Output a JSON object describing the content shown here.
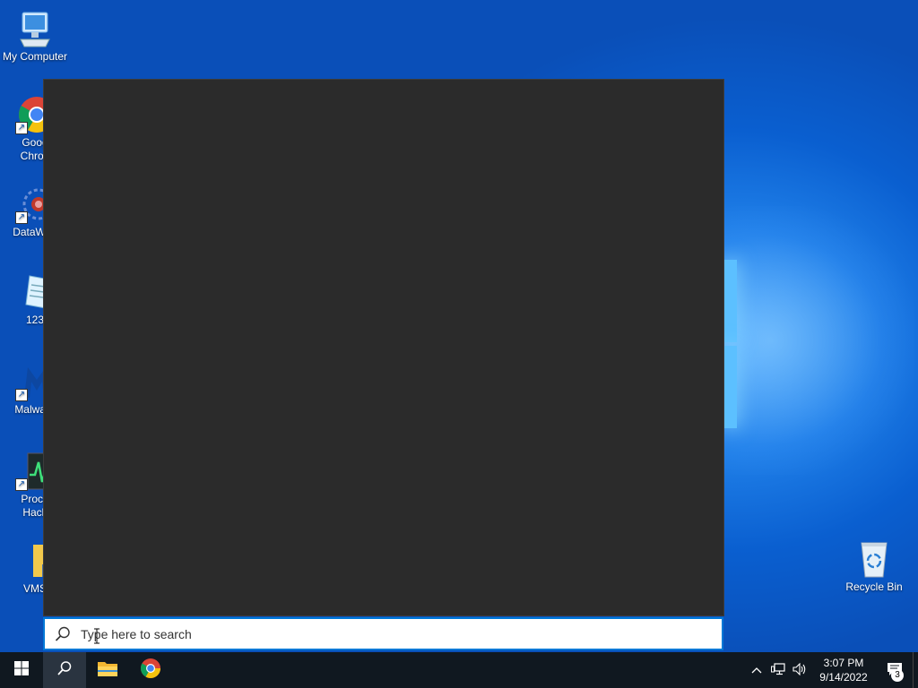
{
  "desktop": {
    "icons": [
      {
        "name": "My Computer",
        "icon": "computer-icon"
      },
      {
        "name": "Goog Chron",
        "line1": "Goog",
        "line2": "Chron",
        "icon": "chrome-icon"
      },
      {
        "name": "DataWag",
        "icon": "datawag-icon"
      },
      {
        "name": "123",
        "icon": "document-icon"
      },
      {
        "name": "Malware",
        "icon": "malwarebytes-icon"
      },
      {
        "name": "Proce Hack",
        "line1": "Proce",
        "line2": "Hack",
        "icon": "process-hacker-icon"
      },
      {
        "name": "VMS",
        "icon": "folder-user-icon"
      },
      {
        "name": "Recycle Bin",
        "icon": "recycle-bin-icon"
      }
    ]
  },
  "search": {
    "placeholder": "Type here to search",
    "value": ""
  },
  "taskbar": {
    "start": "start-icon",
    "search": "search-icon",
    "apps": [
      {
        "name": "File Explorer",
        "icon": "folder-icon"
      },
      {
        "name": "Google Chrome",
        "icon": "chrome-icon"
      }
    ],
    "tray": {
      "time": "3:07 PM",
      "date": "9/14/2022",
      "notifications": "3"
    }
  },
  "colors": {
    "accent": "#0078d7",
    "panel": "#2b2b2b",
    "taskbar": "#101820"
  }
}
